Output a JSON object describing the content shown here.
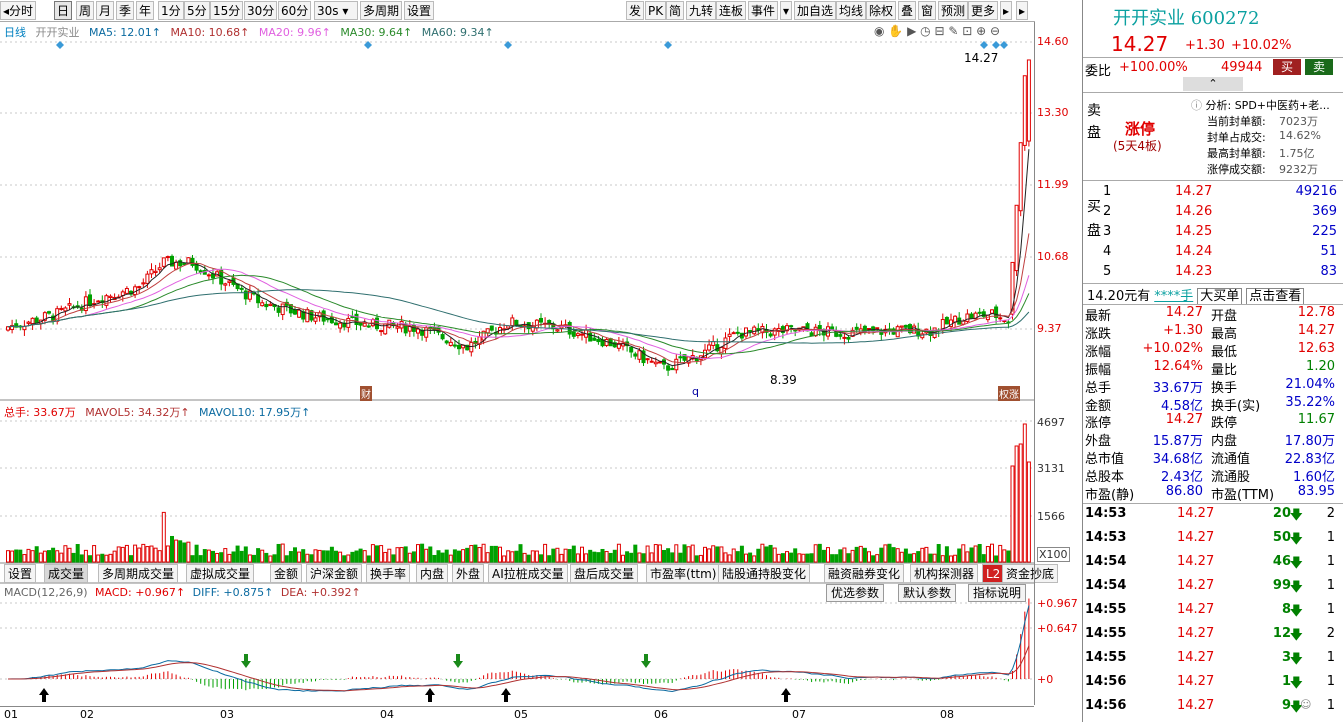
{
  "toolbar": {
    "left": [
      "分时",
      "日",
      "周",
      "月",
      "季",
      "年",
      "1分",
      "5分",
      "15分",
      "30分",
      "60分",
      "30s",
      "多周期",
      "设置"
    ],
    "right": [
      "发",
      "PK",
      "简",
      "九转",
      "连板",
      "事件",
      "加自选",
      "均线",
      "除权",
      "叠",
      "窗",
      "预测",
      "更多"
    ]
  },
  "legend": {
    "period": "日线",
    "stock": "开开实业",
    "ma5": "MA5: 12.01↑",
    "ma10": "MA10: 10.68↑",
    "ma20": "MA20: 9.96↑",
    "ma30": "MA30: 9.64↑",
    "ma60": "MA60: 9.34↑"
  },
  "price_axis": [
    "14.60",
    "13.30",
    "11.99",
    "10.68",
    "9.37"
  ],
  "price_marks": {
    "high": "14.27",
    "low": "8.39",
    "tag1": "财",
    "tag2": "q",
    "tag3": "权涨"
  },
  "volume_legend": {
    "total": "总手: 33.67万",
    "mavol5": "MAVOL5: 34.32万↑",
    "mavol10": "MAVOL10: 17.95万↑"
  },
  "volume_axis": [
    "4697",
    "3131",
    "1566",
    "X100"
  ],
  "tabs": [
    "设置",
    "成交量",
    "多周期成交量",
    "虚拟成交量",
    "金额",
    "沪深金额",
    "换手率",
    "内盘",
    "外盘",
    "AI拉桩成交量",
    "盘后成交量",
    "市盈率(ttm)",
    "陆股通持股变化",
    "融资融券变化",
    "机构探测器",
    "L2",
    "资金抄底"
  ],
  "macd_legend": {
    "name": "MACD(12,26,9)",
    "macd": "MACD: +0.967↑",
    "diff": "DIFF: +0.875↑",
    "dea": "DEA: +0.392↑"
  },
  "macd_buttons": [
    "优选参数",
    "默认参数",
    "指标说明"
  ],
  "macd_axis": [
    "+0.967",
    "+0.647",
    "+0"
  ],
  "x_axis": [
    "01",
    "02",
    "03",
    "04",
    "05",
    "06",
    "07",
    "08"
  ],
  "chart_data": {
    "type": "candlestick",
    "title": "开开实业 日线",
    "price_ylim": [
      8.39,
      14.6
    ],
    "last_close": 14.27,
    "period_high": 14.27,
    "period_low": 8.39,
    "ma": {
      "MA5": 12.01,
      "MA10": 10.68,
      "MA20": 9.96,
      "MA30": 9.64,
      "MA60": 9.34
    },
    "volume_ylim": [
      0,
      4697
    ],
    "macd": {
      "MACD": 0.967,
      "DIFF": 0.875,
      "DEA": 0.392
    },
    "x_labels": [
      "01",
      "02",
      "03",
      "04",
      "05",
      "06",
      "07",
      "08"
    ]
  },
  "quote": {
    "name": "开开实业 600272",
    "price": "14.27",
    "change": "+1.30",
    "pct": "+10.02%",
    "weibi_label": "委比",
    "weibi": "+100.00%",
    "weicha": "49944",
    "buy_btn": "买",
    "sell_btn": "卖",
    "sell_side": "卖盘",
    "limit_up": "涨停",
    "limit_sub": "(5天4板)",
    "analysis": "分析: SPD+中医药+老...",
    "seal_amount_lbl": "当前封单额:",
    "seal_amount": "7023万",
    "seal_ratio_lbl": "封单占成交:",
    "seal_ratio": "14.62%",
    "max_seal_lbl": "最高封单额:",
    "max_seal": "1.75亿",
    "limit_turnover_lbl": "涨停成交额:",
    "limit_turnover": "9232万",
    "buy_side": "买盘",
    "bids": [
      {
        "lv": "1",
        "price": "14.27",
        "vol": "49216"
      },
      {
        "lv": "2",
        "price": "14.26",
        "vol": "369"
      },
      {
        "lv": "3",
        "price": "14.25",
        "vol": "225"
      },
      {
        "lv": "4",
        "price": "14.24",
        "vol": "51"
      },
      {
        "lv": "5",
        "price": "14.23",
        "vol": "83"
      }
    ],
    "ad_bar": [
      "14.20元有",
      "****手",
      "大买单",
      "点击查看"
    ],
    "stats": [
      {
        "l1": "最新",
        "v1": "14.27",
        "l2": "开盘",
        "v2": "12.78"
      },
      {
        "l1": "涨跌",
        "v1": "+1.30",
        "l2": "最高",
        "v2": "14.27"
      },
      {
        "l1": "涨幅",
        "v1": "+10.02%",
        "l2": "最低",
        "v2": "12.63"
      },
      {
        "l1": "振幅",
        "v1": "12.64%",
        "l2": "量比",
        "v2": "1.20"
      },
      {
        "l1": "总手",
        "v1": "33.67万",
        "l2": "换手",
        "v2": "21.04%"
      },
      {
        "l1": "金额",
        "v1": "4.58亿",
        "l2": "换手(实)",
        "v2": "35.22%"
      },
      {
        "l1": "涨停",
        "v1": "14.27",
        "l2": "跌停",
        "v2": "11.67"
      },
      {
        "l1": "外盘",
        "v1": "15.87万",
        "l2": "内盘",
        "v2": "17.80万"
      },
      {
        "l1": "总市值",
        "v1": "34.68亿",
        "l2": "流通值",
        "v2": "22.83亿"
      },
      {
        "l1": "总股本",
        "v1": "2.43亿",
        "l2": "流通股",
        "v2": "1.60亿"
      },
      {
        "l1": "市盈(静)",
        "v1": "86.80",
        "l2": "市盈(TTM)",
        "v2": "83.95"
      }
    ],
    "ticks": [
      {
        "t": "14:53",
        "p": "14.27",
        "v": "20",
        "n": "2"
      },
      {
        "t": "14:53",
        "p": "14.27",
        "v": "50",
        "n": "1"
      },
      {
        "t": "14:54",
        "p": "14.27",
        "v": "46",
        "n": "1"
      },
      {
        "t": "14:54",
        "p": "14.27",
        "v": "99",
        "n": "1"
      },
      {
        "t": "14:55",
        "p": "14.27",
        "v": "8",
        "n": "1"
      },
      {
        "t": "14:55",
        "p": "14.27",
        "v": "12",
        "n": "2"
      },
      {
        "t": "14:55",
        "p": "14.27",
        "v": "3",
        "n": "1"
      },
      {
        "t": "14:56",
        "p": "14.27",
        "v": "1",
        "n": "1"
      },
      {
        "t": "14:56",
        "p": "14.27",
        "v": "9",
        "n": "1"
      }
    ]
  },
  "colors": {
    "up": "#e00000",
    "down": "#00a000",
    "ma5": "#222222",
    "ma10": "#c04040",
    "ma20": "#e060e0",
    "ma30": "#2a8a2a",
    "ma60": "#2f6f6f",
    "bg": "#ffffff"
  }
}
